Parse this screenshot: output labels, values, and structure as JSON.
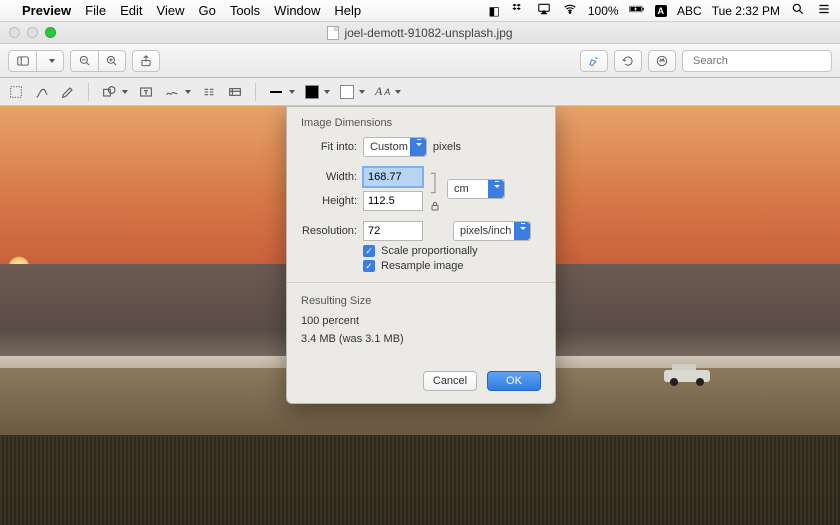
{
  "menubar": {
    "app": "Preview",
    "items": [
      "File",
      "Edit",
      "View",
      "Go",
      "Tools",
      "Window",
      "Help"
    ],
    "battery": "100%",
    "input_badge": "ABC",
    "clock": "Tue 2:32 PM"
  },
  "window": {
    "title": "joel-demott-91082-unsplash.jpg"
  },
  "toolbar": {
    "search_placeholder": "Search"
  },
  "dialog": {
    "section_title": "Image Dimensions",
    "fit_label": "Fit into:",
    "fit_value": "Custom",
    "fit_unit": "pixels",
    "width_label": "Width:",
    "width_value": "168.77",
    "height_label": "Height:",
    "height_value": "112.5",
    "dim_unit": "cm",
    "res_label": "Resolution:",
    "res_value": "72",
    "res_unit": "pixels/inch",
    "scale_label": "Scale proportionally",
    "resample_label": "Resample image",
    "result_title": "Resulting Size",
    "result_percent": "100 percent",
    "result_bytes": "3.4 MB (was 3.1 MB)",
    "cancel": "Cancel",
    "ok": "OK"
  }
}
